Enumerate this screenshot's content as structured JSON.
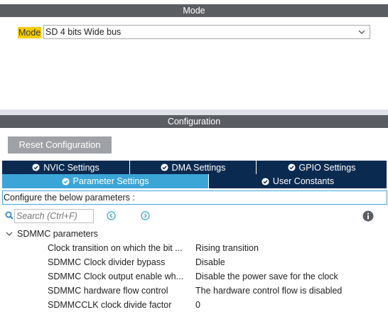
{
  "mode": {
    "header": "Mode",
    "label": "Mode",
    "selected": "SD 4 bits Wide bus"
  },
  "configuration": {
    "header": "Configuration",
    "reset_button": "Reset Configuration",
    "tabs_row1": [
      {
        "label": "NVIC Settings",
        "icon": "check-circle-icon",
        "active": false
      },
      {
        "label": "DMA Settings",
        "icon": "check-circle-icon",
        "active": false
      },
      {
        "label": "GPIO Settings",
        "icon": "check-circle-icon",
        "active": false
      }
    ],
    "tabs_row2": [
      {
        "label": "Parameter Settings",
        "icon": "check-circle-icon",
        "active": true
      },
      {
        "label": "User Constants",
        "icon": "check-circle-icon",
        "active": false
      }
    ],
    "configure_text": "Configure the below parameters :",
    "search_placeholder": "Search (Ctrl+F)",
    "group": {
      "label": "SDMMC parameters",
      "params": [
        {
          "name": "Clock transition on which the bit ...",
          "value": "Rising transition"
        },
        {
          "name": "SDMMC Clock divider bypass",
          "value": "Disable"
        },
        {
          "name": "SDMMC Clock output enable wh...",
          "value": "Disable the power save for the clock"
        },
        {
          "name": "SDMMC hardware flow control",
          "value": "The hardware control flow is disabled"
        },
        {
          "name": "SDMMCCLK clock divide factor",
          "value": "0"
        }
      ]
    }
  },
  "colors": {
    "header_bg": "#5a5e63",
    "tab_bg": "#0b2a50",
    "tab_active_bg": "#3ca5d8",
    "mode_label_bg": "#f5cd0a",
    "reset_bg": "#9ea2a6"
  }
}
